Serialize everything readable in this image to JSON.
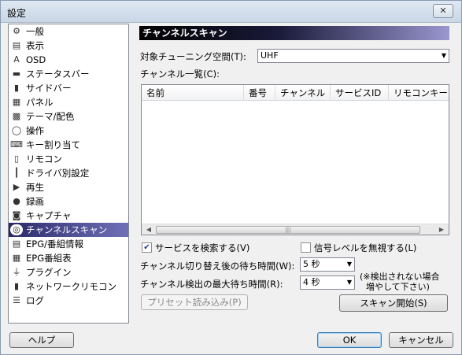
{
  "window": {
    "title": "設定",
    "close_glyph": "✕"
  },
  "sidebar": {
    "items": [
      {
        "label": "一般",
        "icon": "⚙",
        "icon_name": "gear-icon",
        "selected": false
      },
      {
        "label": "表示",
        "icon": "▤",
        "icon_name": "display-icon",
        "selected": false
      },
      {
        "label": "OSD",
        "icon": "A",
        "icon_name": "osd-icon",
        "selected": false
      },
      {
        "label": "ステータスバー",
        "icon": "▬",
        "icon_name": "statusbar-icon",
        "selected": false
      },
      {
        "label": "サイドバー",
        "icon": "▮",
        "icon_name": "sidebar-icon",
        "selected": false
      },
      {
        "label": "パネル",
        "icon": "▦",
        "icon_name": "panel-icon",
        "selected": false
      },
      {
        "label": "テーマ/配色",
        "icon": "▩",
        "icon_name": "theme-icon",
        "selected": false
      },
      {
        "label": "操作",
        "icon": "◯",
        "icon_name": "mouse-icon",
        "selected": false
      },
      {
        "label": "キー割り当て",
        "icon": "⌨",
        "icon_name": "keyboard-icon",
        "selected": false
      },
      {
        "label": "リモコン",
        "icon": "▯",
        "icon_name": "remote-icon",
        "selected": false
      },
      {
        "label": "ドライバ別設定",
        "icon": "┃",
        "icon_name": "driver-icon",
        "selected": false
      },
      {
        "label": "再生",
        "icon": "▶",
        "icon_name": "play-icon",
        "selected": false
      },
      {
        "label": "録画",
        "icon": "●",
        "icon_name": "record-icon",
        "selected": false
      },
      {
        "label": "キャプチャ",
        "icon": "◙",
        "icon_name": "camera-icon",
        "selected": false
      },
      {
        "label": "チャンネルスキャン",
        "icon": "◎",
        "icon_name": "scan-icon",
        "selected": true
      },
      {
        "label": "EPG/番組情報",
        "icon": "▤",
        "icon_name": "epg-info-icon",
        "selected": false
      },
      {
        "label": "EPG番組表",
        "icon": "▦",
        "icon_name": "epg-table-icon",
        "selected": false
      },
      {
        "label": "プラグイン",
        "icon": "⏚",
        "icon_name": "plugin-icon",
        "selected": false
      },
      {
        "label": "ネットワークリモコン",
        "icon": "▮",
        "icon_name": "network-remote-icon",
        "selected": false
      },
      {
        "label": "ログ",
        "icon": "☰",
        "icon_name": "log-icon",
        "selected": false
      }
    ]
  },
  "panel": {
    "title": "チャンネルスキャン",
    "tuning_space_label": "対象チューニング空間(T):",
    "tuning_space_value": "UHF",
    "channel_list_label": "チャンネル一覧(C):",
    "columns": [
      "名前",
      "番号",
      "チャンネル",
      "サービスID",
      "リモコンキー"
    ],
    "scroll_left": "◀",
    "scroll_right": "▶",
    "scroll_grip": "|||",
    "search_services_label": "サービスを検索する(V)",
    "search_services_checked": true,
    "ignore_signal_label": "信号レベルを無視する(L)",
    "ignore_signal_checked": false,
    "wait_after_switch_label": "チャンネル切り替え後の待ち時間(W):",
    "wait_after_switch_value": "5 秒",
    "max_detect_wait_label": "チャンネル検出の最大待ち時間(R):",
    "max_detect_wait_value": "4 秒",
    "note_line1": "(※検出されない場合",
    "note_line2": "増やして下さい)",
    "preset_button": "プリセット読み込み(P)",
    "scan_button": "スキャン開始(S)",
    "check_glyph": "✔"
  },
  "footer": {
    "help_button": "ヘルプ",
    "ok_button": "OK",
    "cancel_button": "キャンセル"
  }
}
